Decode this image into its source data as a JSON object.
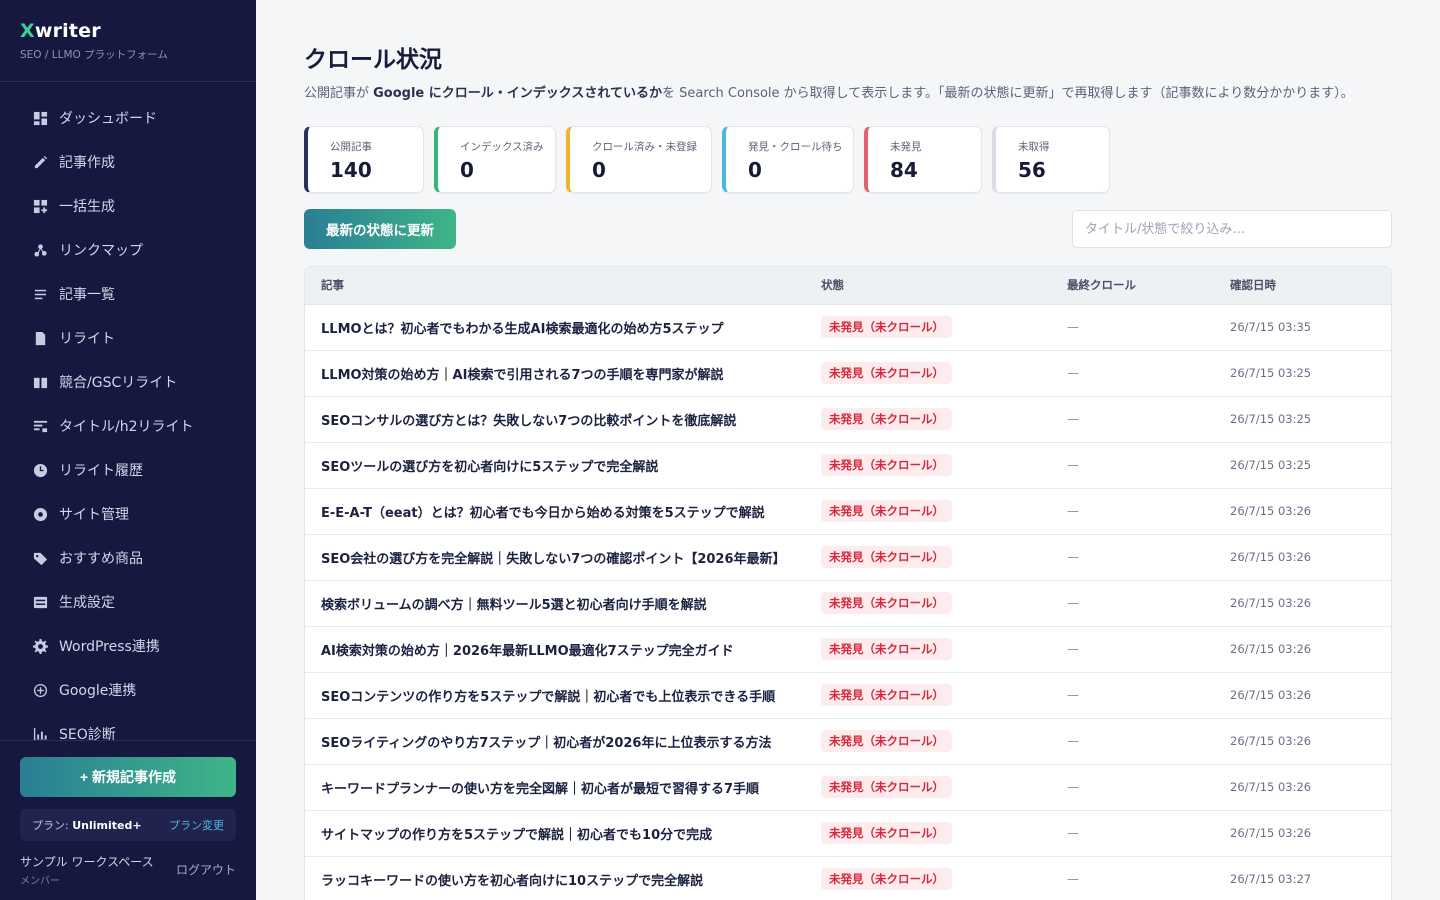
{
  "brand": {
    "x": "X",
    "rest": "writer",
    "sub": "SEO / LLMO プラットフォーム"
  },
  "nav": [
    {
      "label": "ダッシュボード",
      "icon": "dashboard-icon"
    },
    {
      "label": "記事作成",
      "icon": "pencil-icon"
    },
    {
      "label": "一括生成",
      "icon": "grid-add-icon"
    },
    {
      "label": "リンクマップ",
      "icon": "link-map-icon"
    },
    {
      "label": "記事一覧",
      "icon": "list-icon"
    },
    {
      "label": "リライト",
      "icon": "document-icon"
    },
    {
      "label": "競合/GSCリライト",
      "icon": "book-icon"
    },
    {
      "label": "タイトル/h2リライト",
      "icon": "heading-icon"
    },
    {
      "label": "リライト履歴",
      "icon": "clock-icon"
    },
    {
      "label": "サイト管理",
      "icon": "site-icon"
    },
    {
      "label": "おすすめ商品",
      "icon": "tag-icon"
    },
    {
      "label": "生成設定",
      "icon": "settings-box-icon"
    },
    {
      "label": "WordPress連携",
      "icon": "gear-icon"
    },
    {
      "label": "Google連携",
      "icon": "plus-circle-icon"
    },
    {
      "label": "SEO診断",
      "icon": "chart-icon"
    }
  ],
  "sidebar_bottom": {
    "new_article": "+ 新規記事作成",
    "plan_label": "プラン: ",
    "plan_name": "Unlimited+",
    "plan_change": "プラン変更",
    "workspace": "サンプル ワークスペース",
    "role": "メンバー",
    "logout": "ログアウト"
  },
  "page": {
    "title": "クロール状況",
    "desc_1": "公開記事が ",
    "desc_bold": "Google にクロール・インデックスされているか",
    "desc_2": "を Search Console から取得して表示します。「最新の状態に更新」で再取得します（記事数により数分かかります）。"
  },
  "stats": [
    {
      "label": "公開記事",
      "value": "140",
      "color": "#2b2f5a"
    },
    {
      "label": "インデックス済み",
      "value": "0",
      "color": "#34b77a"
    },
    {
      "label": "クロール済み・未登録",
      "value": "0",
      "color": "#f0b429"
    },
    {
      "label": "発見・クロール待ち",
      "value": "0",
      "color": "#4cb8e0"
    },
    {
      "label": "未発見",
      "value": "84",
      "color": "#e4606a"
    },
    {
      "label": "未取得",
      "value": "56",
      "color": "#d9dce4"
    }
  ],
  "toolbar": {
    "refresh": "最新の状態に更新",
    "filter_placeholder": "タイトル/状態で絞り込み…"
  },
  "table": {
    "headers": [
      "記事",
      "状態",
      "最終クロール",
      "確認日時"
    ],
    "rows": [
      {
        "title": "LLMOとは？初心者でもわかる生成AI検索最適化の始め方5ステップ",
        "state": "未発見（未クロール）",
        "crawl": "—",
        "date": "26/7/15 03:35"
      },
      {
        "title": "LLMO対策の始め方｜AI検索で引用される7つの手順を専門家が解説",
        "state": "未発見（未クロール）",
        "crawl": "—",
        "date": "26/7/15 03:25"
      },
      {
        "title": "SEOコンサルの選び方とは？失敗しない7つの比較ポイントを徹底解説",
        "state": "未発見（未クロール）",
        "crawl": "—",
        "date": "26/7/15 03:25"
      },
      {
        "title": "SEOツールの選び方を初心者向けに5ステップで完全解説",
        "state": "未発見（未クロール）",
        "crawl": "—",
        "date": "26/7/15 03:25"
      },
      {
        "title": "E-E-A-T（eeat）とは？初心者でも今日から始める対策を5ステップで解説",
        "state": "未発見（未クロール）",
        "crawl": "—",
        "date": "26/7/15 03:26"
      },
      {
        "title": "SEO会社の選び方を完全解説｜失敗しない7つの確認ポイント【2026年最新】",
        "state": "未発見（未クロール）",
        "crawl": "—",
        "date": "26/7/15 03:26"
      },
      {
        "title": "検索ボリュームの調べ方｜無料ツール5選と初心者向け手順を解説",
        "state": "未発見（未クロール）",
        "crawl": "—",
        "date": "26/7/15 03:26"
      },
      {
        "title": "AI検索対策の始め方｜2026年最新LLMO最適化7ステップ完全ガイド",
        "state": "未発見（未クロール）",
        "crawl": "—",
        "date": "26/7/15 03:26"
      },
      {
        "title": "SEOコンテンツの作り方を5ステップで解説｜初心者でも上位表示できる手順",
        "state": "未発見（未クロール）",
        "crawl": "—",
        "date": "26/7/15 03:26"
      },
      {
        "title": "SEOライティングのやり方7ステップ｜初心者が2026年に上位表示する方法",
        "state": "未発見（未クロール）",
        "crawl": "—",
        "date": "26/7/15 03:26"
      },
      {
        "title": "キーワードプランナーの使い方を完全図解｜初心者が最短で習得する7手順",
        "state": "未発見（未クロール）",
        "crawl": "—",
        "date": "26/7/15 03:26"
      },
      {
        "title": "サイトマップの作り方を5ステップで解説｜初心者でも10分で完成",
        "state": "未発見（未クロール）",
        "crawl": "—",
        "date": "26/7/15 03:26"
      },
      {
        "title": "ラッコキーワードの使い方を初心者向けに10ステップで完全解説",
        "state": "未発見（未クロール）",
        "crawl": "—",
        "date": "26/7/15 03:27"
      }
    ]
  }
}
